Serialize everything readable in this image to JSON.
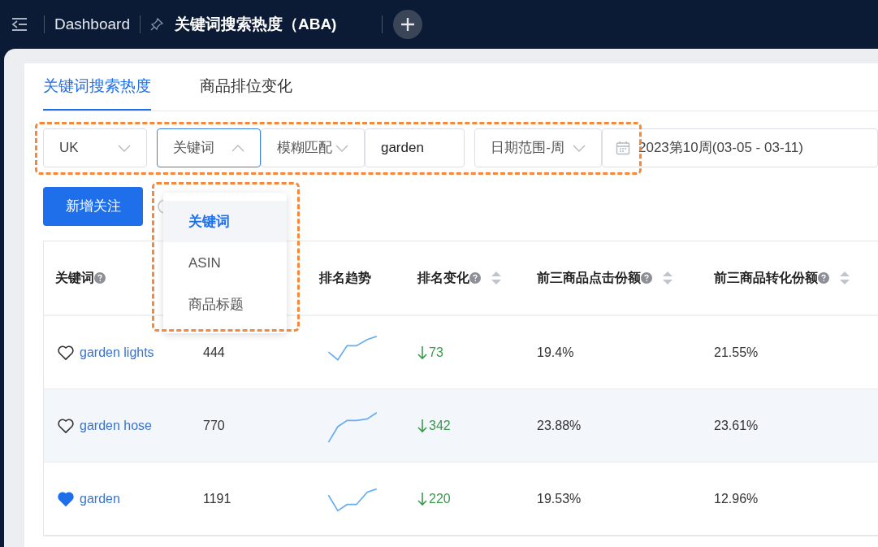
{
  "top_bar": {
    "home_tab": "Dashboard",
    "active_tab": "关键词搜索热度（ABA)"
  },
  "tabs": [
    {
      "label": "关键词搜索热度",
      "selected": true
    },
    {
      "label": "商品排位变化",
      "selected": false
    }
  ],
  "filters": {
    "market": "UK",
    "search_type": "关键词",
    "match_type": "模糊匹配",
    "keyword": "garden",
    "date_range_type": "日期范围-周",
    "date": "2023第10周(03-05 - 03-11)"
  },
  "dropdown": {
    "open": true,
    "options": [
      {
        "label": "关键词",
        "selected": true
      },
      {
        "label": "ASIN",
        "selected": false
      },
      {
        "label": "商品标题",
        "selected": false
      }
    ]
  },
  "add_button": "新增关注",
  "table": {
    "columns": [
      {
        "label": "关键词",
        "help": true,
        "sortable": false
      },
      {
        "label": "排名趋势",
        "help": false,
        "sortable": false
      },
      {
        "label": "排名变化",
        "help": true,
        "sortable": true
      },
      {
        "label": "前三商品点击份额",
        "help": true,
        "sortable": true
      },
      {
        "label": "前三商品转化份额",
        "help": true,
        "sortable": true
      }
    ],
    "rows": [
      {
        "keyword": "garden lights",
        "favorite": false,
        "highlighted": false,
        "rank": "444",
        "change": "73",
        "click_share": "19.4%",
        "conversion_share": "21.55%"
      },
      {
        "keyword": "garden hose",
        "favorite": false,
        "highlighted": true,
        "rank": "770",
        "change": "342",
        "click_share": "23.88%",
        "conversion_share": "23.61%"
      },
      {
        "keyword": "garden",
        "favorite": true,
        "highlighted": false,
        "rank": "1191",
        "change": "220",
        "click_share": "19.53%",
        "conversion_share": "12.96%"
      }
    ]
  }
}
